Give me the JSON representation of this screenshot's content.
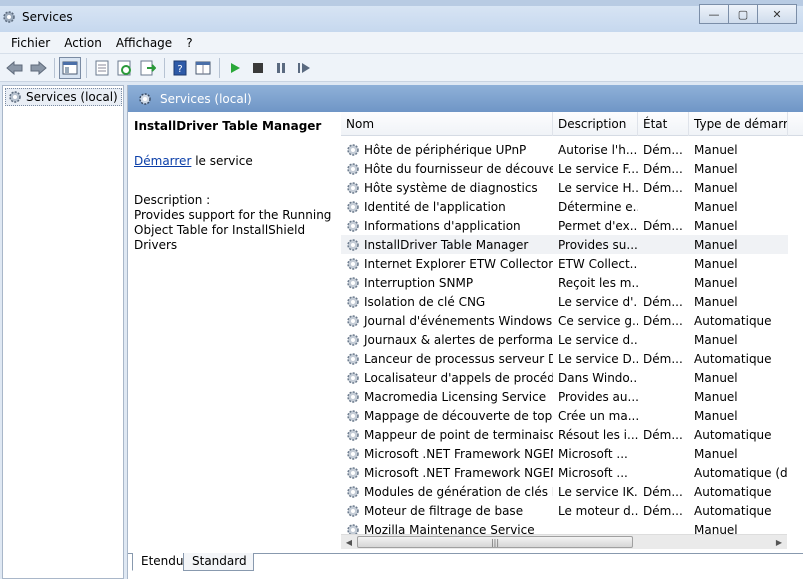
{
  "window": {
    "title": "Services",
    "minimize": "—",
    "maximize": "▢",
    "close": "✕"
  },
  "menu": [
    "Fichier",
    "Action",
    "Affichage",
    "?"
  ],
  "toolbar": [
    "back-icon",
    "forward-icon",
    "show-tree-icon",
    "properties-icon",
    "refresh-icon",
    "export-icon",
    "help-icon",
    "console-icon",
    "start-icon",
    "stop-icon",
    "pause-icon",
    "restart-icon"
  ],
  "tree": {
    "root": "Services (local)"
  },
  "pane": {
    "header": "Services (local)"
  },
  "details": {
    "service_name": "InstallDriver Table Manager",
    "start_link": "Démarrer",
    "start_suffix": " le service",
    "description_label": "Description :",
    "description_text": "Provides support for the Running Object Table for InstallShield Drivers"
  },
  "columns": [
    "Nom",
    "Description",
    "État",
    "Type de démarrage"
  ],
  "rows": [
    {
      "name": "Hôte de périphérique UPnP",
      "desc": "Autorise l'h...",
      "state": "Dém...",
      "type": "Manuel"
    },
    {
      "name": "Hôte du fournisseur de découvert...",
      "desc": "Le service F...",
      "state": "Dém...",
      "type": "Manuel"
    },
    {
      "name": "Hôte système de diagnostics",
      "desc": "Le service H...",
      "state": "Dém...",
      "type": "Manuel"
    },
    {
      "name": "Identité de l'application",
      "desc": "Détermine e...",
      "state": "",
      "type": "Manuel"
    },
    {
      "name": "Informations d'application",
      "desc": "Permet d'ex...",
      "state": "Dém...",
      "type": "Manuel"
    },
    {
      "name": "InstallDriver Table Manager",
      "desc": "Provides su...",
      "state": "",
      "type": "Manuel",
      "selected": true
    },
    {
      "name": "Internet Explorer ETW Collector Se...",
      "desc": "ETW Collect...",
      "state": "",
      "type": "Manuel"
    },
    {
      "name": "Interruption SNMP",
      "desc": "Reçoit les m...",
      "state": "",
      "type": "Manuel"
    },
    {
      "name": "Isolation de clé CNG",
      "desc": "Le service d'...",
      "state": "Dém...",
      "type": "Manuel"
    },
    {
      "name": "Journal d'événements Windows",
      "desc": "Ce service g...",
      "state": "Dém...",
      "type": "Automatique"
    },
    {
      "name": "Journaux & alertes de performance",
      "desc": "Le service d...",
      "state": "",
      "type": "Manuel"
    },
    {
      "name": "Lanceur de processus serveur DC...",
      "desc": "Le service D...",
      "state": "Dém...",
      "type": "Automatique"
    },
    {
      "name": "Localisateur d'appels de procédur...",
      "desc": "Dans Windo...",
      "state": "",
      "type": "Manuel"
    },
    {
      "name": "Macromedia Licensing Service",
      "desc": "Provides au...",
      "state": "",
      "type": "Manuel"
    },
    {
      "name": "Mappage de découverte de topol...",
      "desc": "Crée un ma...",
      "state": "",
      "type": "Manuel"
    },
    {
      "name": "Mappeur de point de terminaison ...",
      "desc": "Résout les i...",
      "state": "Dém...",
      "type": "Automatique"
    },
    {
      "name": "Microsoft .NET Framework NGEN ...",
      "desc": "Microsoft ...",
      "state": "",
      "type": "Manuel"
    },
    {
      "name": "Microsoft .NET Framework NGEN ...",
      "desc": "Microsoft ...",
      "state": "",
      "type": "Automatique (dé"
    },
    {
      "name": "Modules de génération de clés IKE...",
      "desc": "Le service IK...",
      "state": "Dém...",
      "type": "Automatique"
    },
    {
      "name": "Moteur de filtrage de base",
      "desc": "Le moteur d...",
      "state": "Dém...",
      "type": "Automatique"
    },
    {
      "name": "Mozilla Maintenance Service",
      "desc": "",
      "state": "",
      "type": "Manuel"
    }
  ],
  "tabs": [
    "Etendu",
    "Standard"
  ]
}
